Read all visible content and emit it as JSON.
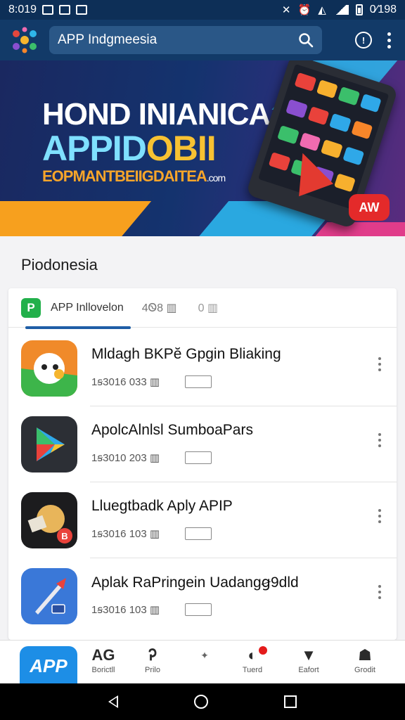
{
  "status_bar": {
    "time": "8:019",
    "battery_text": "0⁄198",
    "icons": [
      "image-icon",
      "check-icon",
      "id-icon",
      "mute-icon",
      "alarm-icon",
      "wifi-icon",
      "signal-icon",
      "battery-icon"
    ]
  },
  "app_bar": {
    "search_text": "APP Indgmeesia",
    "icons": [
      "app-logo",
      "search-icon",
      "info-icon",
      "more-vert-icon"
    ]
  },
  "banner": {
    "title": "HOND INIANICA",
    "subtitle_a": "APPID",
    "subtitle_b": "OBII",
    "tagline": "EOPMANTBEIIGDAITEA",
    "tagline_suffix": ".com",
    "badge": "AW"
  },
  "section": {
    "title": "Piodonesia"
  },
  "tabs": {
    "logo": "P",
    "label": "APP Inllovelon",
    "count_a": "4Ꮻ8 ▥",
    "count_b": "0 ▥"
  },
  "apps": [
    {
      "name": "Mldagh BKPĕ Gpgin Bliaking",
      "meta": "1ꞩ3016 033 ▥",
      "icon": "chat-app-icon"
    },
    {
      "name": "ApolcAlnlsl SumboaPars",
      "meta": "1ꞩ3010 203 ▥",
      "icon": "play-app-icon"
    },
    {
      "name": "Lluegtbadk Aply APIP",
      "meta": "1ꞩ3016 103 ▥",
      "icon": "paint-app-icon"
    },
    {
      "name": "Aplak RaPringein Uadangꞡ9dld",
      "meta": "1ꞩ3016 103 ▥",
      "icon": "tools-app-icon"
    }
  ],
  "bottom_nav": {
    "app_label": "APP",
    "items": [
      {
        "glyph": "AG",
        "label": "Borictll"
      },
      {
        "glyph": "Ꭾ",
        "label": "Prilo"
      },
      {
        "glyph": "✦",
        "label": ""
      },
      {
        "glyph": "◐",
        "label": "Tuerd"
      },
      {
        "glyph": "▼",
        "label": "Eafort"
      },
      {
        "glyph": "☗",
        "label": "Grodit"
      }
    ]
  },
  "colors": {
    "status_bar": "#0d2f57",
    "app_bar": "#123a68",
    "accent": "#1f5ea6",
    "badge_red": "#e42a2a"
  }
}
